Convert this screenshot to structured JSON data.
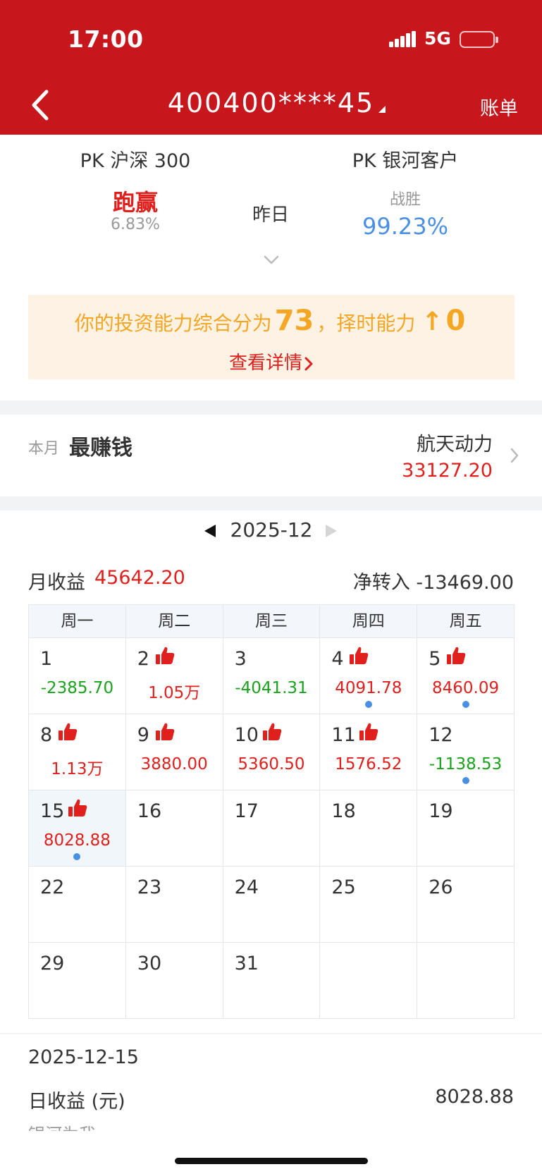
{
  "status_bar": {
    "time": "17:00",
    "network": "5G"
  },
  "header": {
    "account": "400400****45",
    "bill_label": "账单"
  },
  "pk": {
    "left_title": "PK 沪深 300",
    "left_status": "跑赢",
    "left_pct": "6.83%",
    "center_label": "昨日",
    "right_title": "PK 银河客户",
    "right_status": "战胜",
    "right_pct": "99.23%"
  },
  "score": {
    "prefix": "你的投资能力综合分为",
    "value": "73",
    "middle": "，择时能力",
    "arrow": "↑",
    "timing": "0",
    "detail": "查看详情"
  },
  "best": {
    "month_label": "本月",
    "title": "最赚钱",
    "stock": "航天动力",
    "value": "33127.20"
  },
  "month_nav": {
    "label": "2025-12"
  },
  "summary": {
    "income_label": "月收益",
    "income_value": "45642.20",
    "net_in": "净转入 -13469.00"
  },
  "calendar": {
    "weekdays": [
      "周一",
      "周二",
      "周三",
      "周四",
      "周五"
    ],
    "rows": [
      [
        {
          "day": "1",
          "amount": "-2385.70",
          "sign": "neg",
          "thumb": false,
          "dot": false
        },
        {
          "day": "2",
          "amount": "1.05万",
          "sign": "pos",
          "thumb": true,
          "dot": false
        },
        {
          "day": "3",
          "amount": "-4041.31",
          "sign": "neg",
          "thumb": false,
          "dot": false
        },
        {
          "day": "4",
          "amount": "4091.78",
          "sign": "pos",
          "thumb": true,
          "dot": true
        },
        {
          "day": "5",
          "amount": "8460.09",
          "sign": "pos",
          "thumb": true,
          "dot": true
        }
      ],
      [
        {
          "day": "8",
          "amount": "1.13万",
          "sign": "pos",
          "thumb": true,
          "dot": false
        },
        {
          "day": "9",
          "amount": "3880.00",
          "sign": "pos",
          "thumb": true,
          "dot": false
        },
        {
          "day": "10",
          "amount": "5360.50",
          "sign": "pos",
          "thumb": true,
          "dot": false
        },
        {
          "day": "11",
          "amount": "1576.52",
          "sign": "pos",
          "thumb": true,
          "dot": false
        },
        {
          "day": "12",
          "amount": "-1138.53",
          "sign": "neg",
          "thumb": false,
          "dot": true
        }
      ],
      [
        {
          "day": "15",
          "amount": "8028.88",
          "sign": "pos",
          "thumb": true,
          "dot": true,
          "selected": true
        },
        {
          "day": "16"
        },
        {
          "day": "17"
        },
        {
          "day": "18"
        },
        {
          "day": "19"
        }
      ],
      [
        {
          "day": "22"
        },
        {
          "day": "23"
        },
        {
          "day": "24"
        },
        {
          "day": "25"
        },
        {
          "day": "26"
        }
      ],
      [
        {
          "day": "29"
        },
        {
          "day": "30"
        },
        {
          "day": "31"
        },
        {
          "day": ""
        },
        {
          "day": ""
        }
      ]
    ]
  },
  "selected_day": {
    "date": "2025-12-15",
    "income_label": "日收益 (元)",
    "income_value": "8028.88"
  },
  "cut_text": "银河为我",
  "colors": {
    "header_red": "#c8161d",
    "gain_red": "#e0201d",
    "loss_green": "#19a31c",
    "blue": "#4a90e2",
    "orange": "#f5a623"
  }
}
